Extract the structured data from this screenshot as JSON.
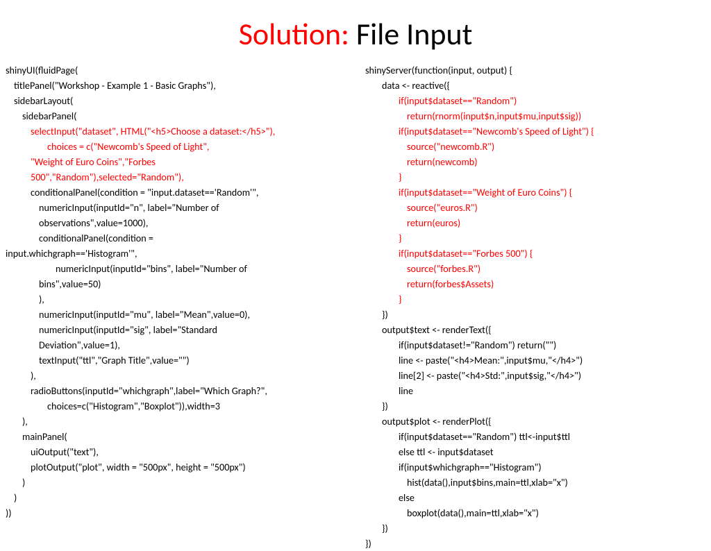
{
  "title": {
    "red": "Solution:",
    "black": " File Input"
  },
  "left": {
    "l1": "shinyUI(fluidPage(",
    "l2": "titlePanel(\"Workshop - Example 1 - Basic Graphs\"),",
    "l3": "sidebarLayout(",
    "l4": "sidebarPanel(",
    "l5": "selectInput(\"dataset\", HTML(\"<h5>Choose a dataset:</h5>\"),",
    "l6": "choices = c(\"Newcomb's Speed of Light\",",
    "l7a": "\"Weight of Euro Coins\",\"Forbes",
    "l7b": "500\",\"Random\"),selected=\"Random\"),",
    "l8": "conditionalPanel(condition = \"input.dataset=='Random'\",",
    "l9a": "numericInput(inputId=\"n\", label=\"Number of",
    "l9b": "observations\",value=1000),",
    "l10a": "conditionalPanel(condition =",
    "l10b": "input.whichgraph=='Histogram'\",",
    "l11a": "numericInput(inputId=\"bins\", label=\"Number of",
    "l11b": "bins\",value=50)",
    "l12": "),",
    "l13": "numericInput(inputId=\"mu\", label=\"Mean\",value=0),",
    "l14a": "numericInput(inputId=\"sig\", label=\"Standard",
    "l14b": "Deviation\",value=1),",
    "l15": "textInput(\"ttl\",\"Graph Title\",value=\"\")",
    "l16": "),",
    "l17": "radioButtons(inputId=\"whichgraph\",label=\"Which Graph?\",",
    "l18": "choices=c(\"Histogram\",\"Boxplot\")),width=3",
    "l19": "),",
    "l20": "mainPanel(",
    "l21": "uiOutput(\"text\"),",
    "l22": "plotOutput(\"plot\", width = \"500px\", height = \"500px\")",
    "l23": ")",
    "l24": ")",
    "l25": "))"
  },
  "right": {
    "r1": "shinyServer(function(input, output) {",
    "r2": "data <- reactive({",
    "r3": "if(input$dataset==\"Random\")",
    "r4": "return(rnorm(input$n,input$mu,input$sig))",
    "r5": "if(input$dataset==\"Newcomb's Speed of Light\") {",
    "r6": "source(\"newcomb.R\")",
    "r7": "return(newcomb)",
    "r8": "}",
    "r9": "if(input$dataset==\"Weight of Euro Coins\") {",
    "r10": "source(\"euros.R\")",
    "r11": "return(euros)",
    "r12": "}",
    "r13": "if(input$dataset==\"Forbes 500\") {",
    "r14": "source(\"forbes.R\")",
    "r15": "return(forbes$Assets)",
    "r16": "}",
    "r17": "})",
    "r18": "output$text <- renderText({",
    "r19": "if(input$dataset!=\"Random\") return(\"\")",
    "r20": "line <- paste(\"<h4>Mean:\",input$mu,\"</h4>\")",
    "r21": "line[2] <- paste(\"<h4>Std:\",input$sig,\"</h4>\")",
    "r22": "line",
    "r23": "})",
    "r24": "output$plot <- renderPlot({",
    "r25": "if(input$dataset==\"Random\") ttl<-input$ttl",
    "r26": "else ttl <- input$dataset",
    "r27": "if(input$whichgraph==\"Histogram\")",
    "r28": "hist(data(),input$bins,main=ttl,xlab=\"x\")",
    "r29": "else",
    "r30": "boxplot(data(),main=ttl,xlab=\"x\")",
    "r31": "})",
    "r32": "})"
  }
}
